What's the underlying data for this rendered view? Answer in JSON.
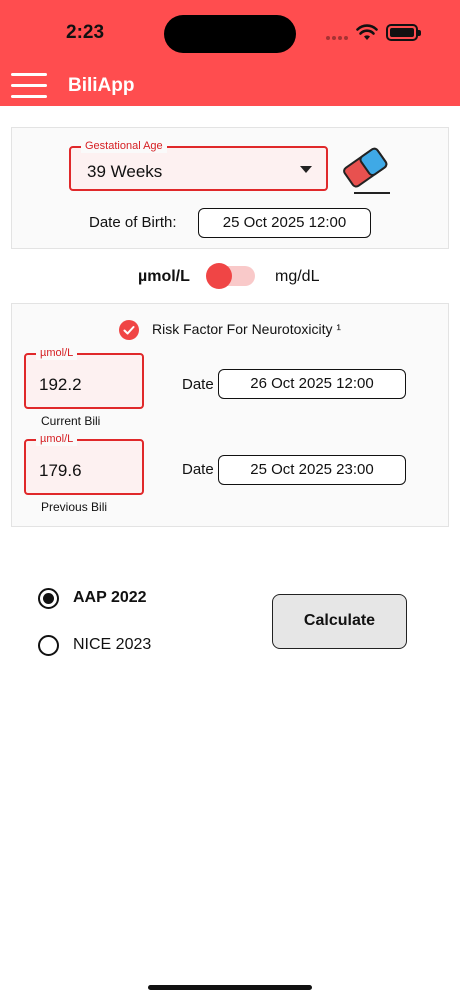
{
  "status_bar": {
    "time": "2:23"
  },
  "header": {
    "title": "BiliApp"
  },
  "gestation": {
    "field_label": "Gestational Age",
    "selected_value": "39 Weeks",
    "dob_label": "Date of Birth:",
    "dob_value": "25 Oct 2025  12:00"
  },
  "units": {
    "left_label": "µmol/L",
    "right_label": "mg/dL"
  },
  "bili": {
    "risk_factor_label": "Risk Factor For Neurotoxicity ¹",
    "current": {
      "unit_label": "µmol/L",
      "value": "192.2",
      "caption": "Current Bili",
      "date_label": "Date",
      "date_value": "26 Oct 2025  12:00"
    },
    "previous": {
      "unit_label": "µmol/L",
      "value": "179.6",
      "caption": "Previous Bili",
      "date_label": "Date",
      "date_value": "25 Oct 2025  23:00"
    }
  },
  "guidelines": {
    "option_1": "AAP 2022",
    "option_2": "NICE 2023"
  },
  "actions": {
    "calculate_label": "Calculate"
  },
  "colors": {
    "accent": "#ff4d4f",
    "field_border": "#e0282a",
    "toggle_knob": "#f04545"
  },
  "icons": [
    "menu-icon",
    "eraser-icon",
    "chevron-down-icon",
    "check-icon",
    "wifi-icon",
    "battery-icon"
  ]
}
